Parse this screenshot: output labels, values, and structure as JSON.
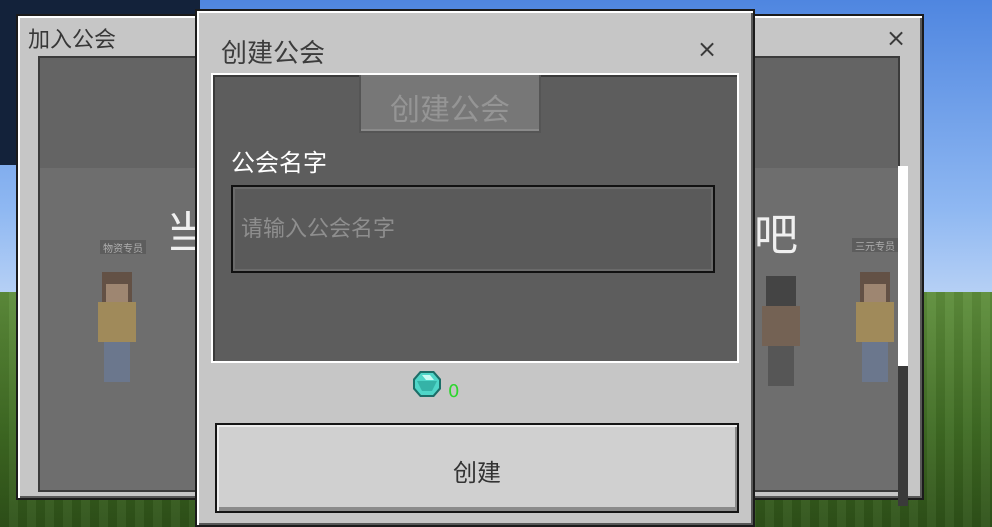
{
  "join_panel": {
    "title": "加入公会",
    "bg_text_left": "当",
    "tags": [
      "物资专员",
      "三元专员"
    ]
  },
  "right_panel": {
    "close_label": "×",
    "bg_text_right": "会吧"
  },
  "create_dialog": {
    "title": "创建公会",
    "close_label": "×",
    "header_button_label": "创建公会",
    "field_label": "公会名字",
    "name_input": {
      "placeholder": "请输入公会名字",
      "value": ""
    },
    "cost": {
      "icon": "diamond-icon",
      "value": "0"
    },
    "create_button_label": "创建"
  },
  "colors": {
    "panel": "#c6c6c6",
    "content": "#5d5d5d",
    "accent_green": "#2dd62d",
    "diamond": "#4fd6c8"
  }
}
